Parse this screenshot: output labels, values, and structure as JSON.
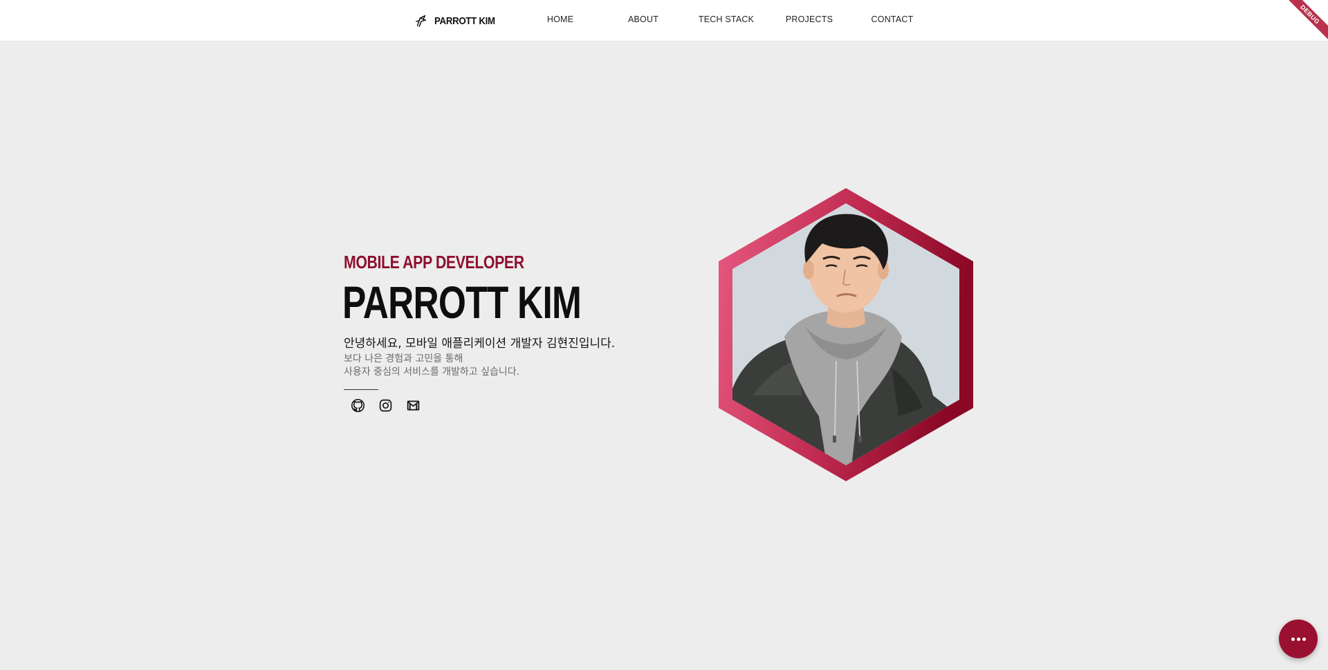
{
  "nav": {
    "brand": "PARROTT KIM",
    "brand_icon": "parrot-logo-icon",
    "items": [
      "HOME",
      "ABOUT",
      "TECH STACK",
      "PROJECTS",
      "CONTACT"
    ]
  },
  "debug_banner": "DEBUG",
  "hero": {
    "role": "MOBILE APP DEVELOPER",
    "name": "PARROTT KIM",
    "greeting": "안녕하세요, 모바일 애플리케이션 개발자 김현진입니다.",
    "desc_line1": "보다 나은 경험과 고민을 통해",
    "desc_line2": "사용자 중심의 서비스를 개발하고 싶습니다.",
    "socials": [
      "github-icon",
      "instagram-icon",
      "gmail-icon"
    ]
  },
  "portrait": {
    "subject": "profile-photo",
    "frame": "hexagon"
  },
  "fab": {
    "icon": "more-dots-icon"
  },
  "colors": {
    "accent": "#8e0f2e",
    "hex_light": "#e85a80",
    "hex_dark": "#8a0826",
    "background": "#ededed",
    "nav_bg": "#ffffff",
    "fab": "#9a1030"
  }
}
